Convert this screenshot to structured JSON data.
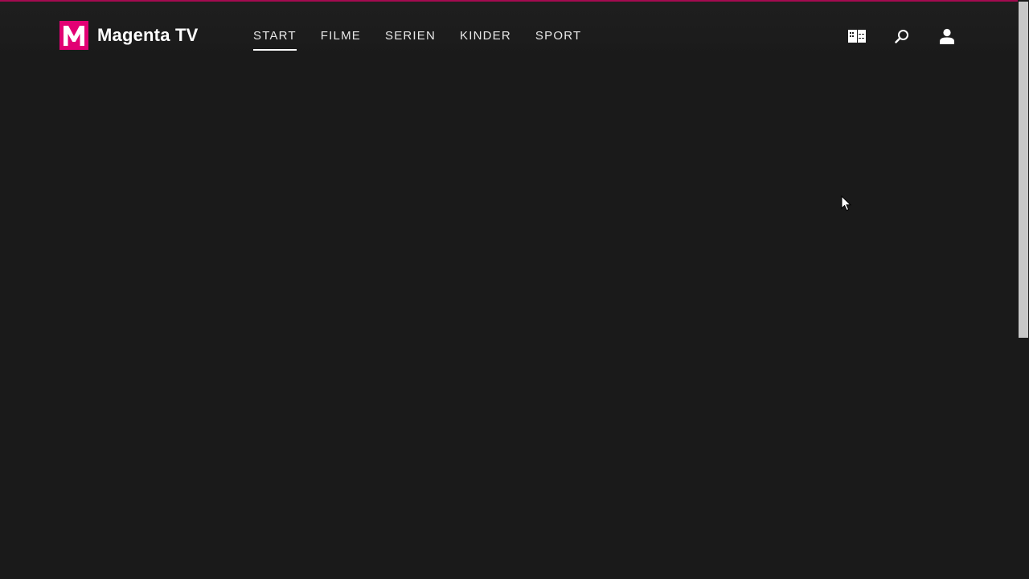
{
  "brand": {
    "logo_letter": "M",
    "name": "Magenta TV",
    "color": "#e20074"
  },
  "nav": {
    "items": [
      {
        "label": "START",
        "active": true
      },
      {
        "label": "FILME",
        "active": false
      },
      {
        "label": "SERIEN",
        "active": false
      },
      {
        "label": "KINDER",
        "active": false
      },
      {
        "label": "SPORT",
        "active": false
      }
    ]
  },
  "actions": {
    "icons": [
      "tv-guide-icon",
      "search-icon",
      "user-icon"
    ]
  },
  "theme": {
    "background": "#1a1a1a",
    "accent_line": "#a30a50",
    "text": "#ffffff"
  }
}
